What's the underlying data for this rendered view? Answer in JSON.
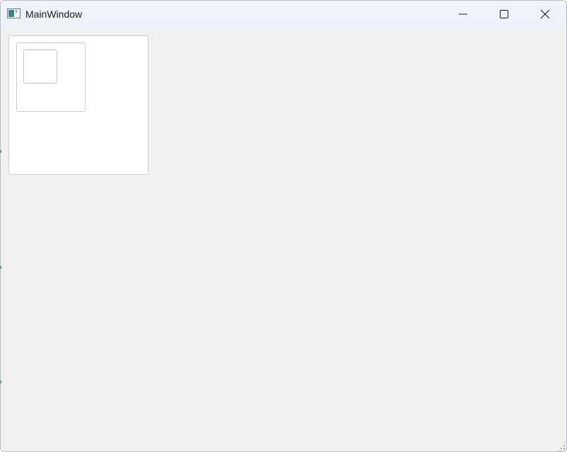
{
  "window": {
    "title": "MainWindow",
    "icons": {
      "app": "app-window-icon",
      "minimize": "minimize-icon",
      "maximize": "maximize-icon",
      "close": "close-icon",
      "grip": "resize-grip-icon"
    },
    "colors": {
      "titlebar": "#eef3fa",
      "client_background": "#f0f0f0",
      "panel_background": "#ffffff",
      "panel_border": "#cfcfcf"
    }
  }
}
